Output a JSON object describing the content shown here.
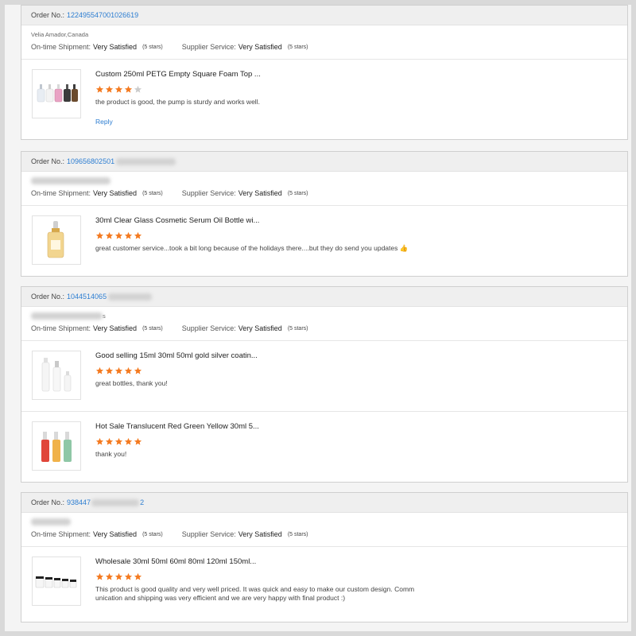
{
  "labels": {
    "order_no": "Order No.:",
    "ontime_shipment": "On-time Shipment:",
    "supplier_service": "Supplier Service:"
  },
  "colors": {
    "star_on": "#f47a20",
    "star_off": "#cccccc",
    "link": "#2c7dd1"
  },
  "orders": [
    {
      "order_no": "122495547001026619",
      "buyer": "Velia Amador,Canada",
      "ontime_value": "Very Satisfied",
      "ontime_stars": "(5 stars)",
      "supplier_value": "Very Satisfied",
      "supplier_stars": "(5 stars)",
      "items": [
        {
          "title": "Custom 250ml PETG Empty Square Foam Top ...",
          "rating": 4,
          "comment": "the product is good, the pump is sturdy and works well.",
          "reply": "Reply",
          "thumb_icon": "foam-pump-bottles"
        }
      ]
    },
    {
      "order_no": "109656802501",
      "buyer": "",
      "ontime_value": "Very Satisfied",
      "ontime_stars": "(5 stars)",
      "supplier_value": "Very Satisfied",
      "supplier_stars": "(5 stars)",
      "items": [
        {
          "title": "30ml Clear Glass Cosmetic Serum Oil Bottle wi...",
          "rating": 5,
          "comment": "great customer service...took a bit long because of the holidays there....but they do send you updates 👍",
          "thumb_icon": "serum-dropper-bottle"
        }
      ]
    },
    {
      "order_no": "1044514065",
      "buyer": "s",
      "ontime_value": "Very Satisfied",
      "ontime_stars": "(5 stars)",
      "supplier_value": "Very Satisfied",
      "supplier_stars": "(5 stars)",
      "items": [
        {
          "title": "Good selling 15ml 30ml 50ml gold silver coatin...",
          "rating": 5,
          "comment": "great bottles, thank you!",
          "thumb_icon": "white-lotion-bottles"
        },
        {
          "title": "Hot Sale Translucent Red Green Yellow 30ml 5...",
          "rating": 5,
          "comment": "thank you!",
          "thumb_icon": "colored-spray-bottles"
        }
      ]
    },
    {
      "order_no_start": "938447",
      "order_no_end": "2",
      "buyer": "",
      "ontime_value": "Very Satisfied",
      "ontime_stars": "(5 stars)",
      "supplier_value": "Very Satisfied",
      "supplier_stars": "(5 stars)",
      "items": [
        {
          "title": "Wholesale 30ml 50ml 60ml 80ml 120ml 150ml...",
          "rating": 5,
          "comment_line1": "This product is good quality and very well priced. It was quick and easy to make our custom design. Comm",
          "comment_line2": "unication and shipping was very efficient and we are very happy with final product :)",
          "thumb_icon": "clear-jars"
        }
      ]
    }
  ]
}
